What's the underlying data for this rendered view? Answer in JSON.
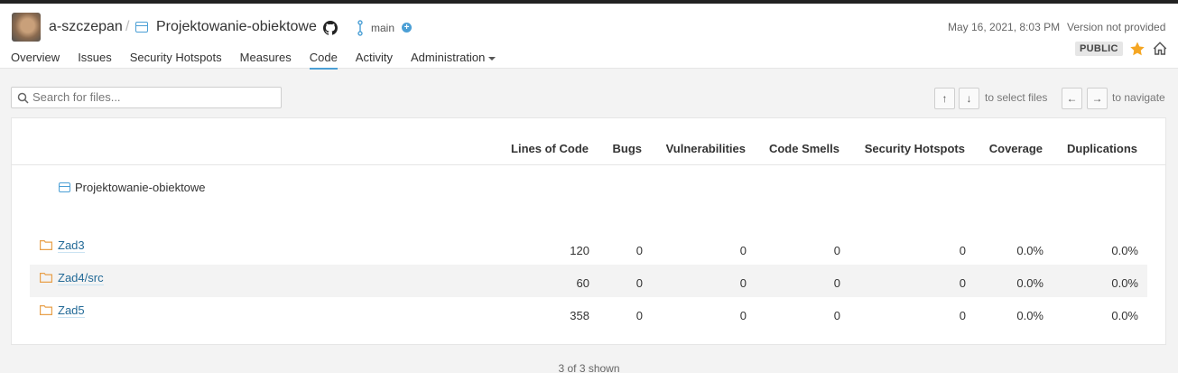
{
  "header": {
    "owner": "a-szczepan",
    "separator": "/",
    "project": "Projektowanie-obiektowe",
    "branch": "main",
    "date": "May 16, 2021, 8:03 PM",
    "version": "Version not provided",
    "visibility": "PUBLIC"
  },
  "nav": {
    "items": [
      "Overview",
      "Issues",
      "Security Hotspots",
      "Measures",
      "Code",
      "Activity",
      "Administration"
    ],
    "active": "Code"
  },
  "search": {
    "placeholder": "Search for files..."
  },
  "keyboard": {
    "up": "↑",
    "down": "↓",
    "select_hint": "to select files",
    "left": "←",
    "right": "→",
    "navigate_hint": "to navigate"
  },
  "table": {
    "columns": [
      "Lines of Code",
      "Bugs",
      "Vulnerabilities",
      "Code Smells",
      "Security Hotspots",
      "Coverage",
      "Duplications"
    ],
    "root": "Projektowanie-obiektowe",
    "rows": [
      {
        "name": "Zad3",
        "loc": "120",
        "bugs": "0",
        "vulnerabilities": "0",
        "smells": "0",
        "hotspots": "0",
        "coverage": "0.0%",
        "duplications": "0.0%"
      },
      {
        "name": "Zad4/src",
        "loc": "60",
        "bugs": "0",
        "vulnerabilities": "0",
        "smells": "0",
        "hotspots": "0",
        "coverage": "0.0%",
        "duplications": "0.0%"
      },
      {
        "name": "Zad5",
        "loc": "358",
        "bugs": "0",
        "vulnerabilities": "0",
        "smells": "0",
        "hotspots": "0",
        "coverage": "0.0%",
        "duplications": "0.0%"
      }
    ]
  },
  "footer": {
    "shown": "3 of 3 shown"
  },
  "colors": {
    "accent": "#4b9fd5",
    "star": "#f5a623",
    "folder": "#e8a04a",
    "link": "#236a97"
  },
  "icons": [
    "avatar",
    "project-icon",
    "github-icon",
    "branch-icon",
    "plus-icon",
    "star-icon",
    "home-icon",
    "search-icon",
    "folder-icon"
  ]
}
